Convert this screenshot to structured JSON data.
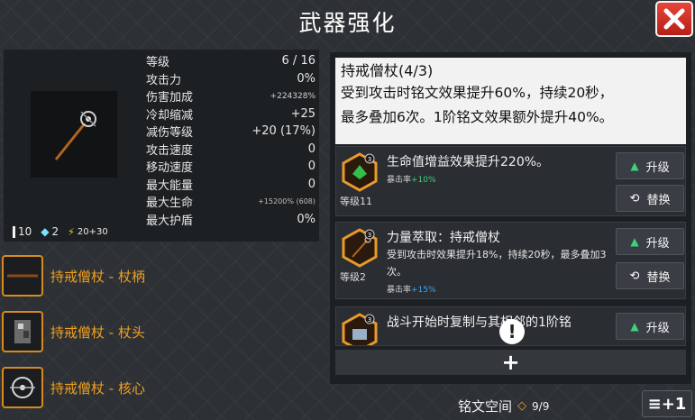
{
  "title": "武器强化",
  "stats": [
    {
      "label": "等级",
      "value": "6 / 16",
      "size": "normal"
    },
    {
      "label": "攻击力",
      "value": "0%",
      "size": "normal"
    },
    {
      "label": "伤害加成",
      "value": "+224328%",
      "size": "small"
    },
    {
      "label": "冷却缩减",
      "value": "+25",
      "size": "normal"
    },
    {
      "label": "减伤等级",
      "value": "+20 (17%)",
      "size": "normal"
    },
    {
      "label": "攻击速度",
      "value": "0",
      "size": "normal"
    },
    {
      "label": "移动速度",
      "value": "0",
      "size": "normal"
    },
    {
      "label": "最大能量",
      "value": "0",
      "size": "normal"
    },
    {
      "label": "最大生命",
      "value": "+15200% (608)",
      "size": "tiny"
    },
    {
      "label": "最大护盾",
      "value": "0%",
      "size": "normal"
    }
  ],
  "resources": {
    "ammo": "10",
    "crystal": "2",
    "energy": "20+30"
  },
  "parts": [
    {
      "label": "持戒僧杖 - 杖柄"
    },
    {
      "label": "持戒僧杖 - 杖头"
    },
    {
      "label": "持戒僧杖 - 核心"
    }
  ],
  "description": {
    "title": "持戒僧杖(4/3)",
    "line1": "受到攻击时铭文效果提升60%，持续20秒，",
    "line2": "最多叠加6次。1阶铭文效果额外提升40%。"
  },
  "runes": [
    {
      "tier": "3",
      "title": "生命值增益效果提升220%。",
      "sub": "",
      "crit_label": "暴击率",
      "crit_value": "+10%",
      "crit_color": "#3fd27a",
      "level": "等级11"
    },
    {
      "tier": "3",
      "title": "力量萃取：持戒僧杖",
      "sub": "受到攻击时效果提升18%，持续20秒，最多叠加3次。",
      "crit_label": "暴击率",
      "crit_value": "+15%",
      "crit_color": "#39a8f0",
      "level": "等级2"
    },
    {
      "tier": "3",
      "title": "战斗开始时复制与其相邻的1阶铭",
      "sub": "",
      "crit_label": "",
      "crit_value": "",
      "crit_color": "#3fd27a",
      "level": ""
    }
  ],
  "buttons": {
    "upgrade": "升级",
    "replace": "替换"
  },
  "rune_space": {
    "label": "铭文空间",
    "count": "9/9"
  },
  "expand_label": "≡+1"
}
